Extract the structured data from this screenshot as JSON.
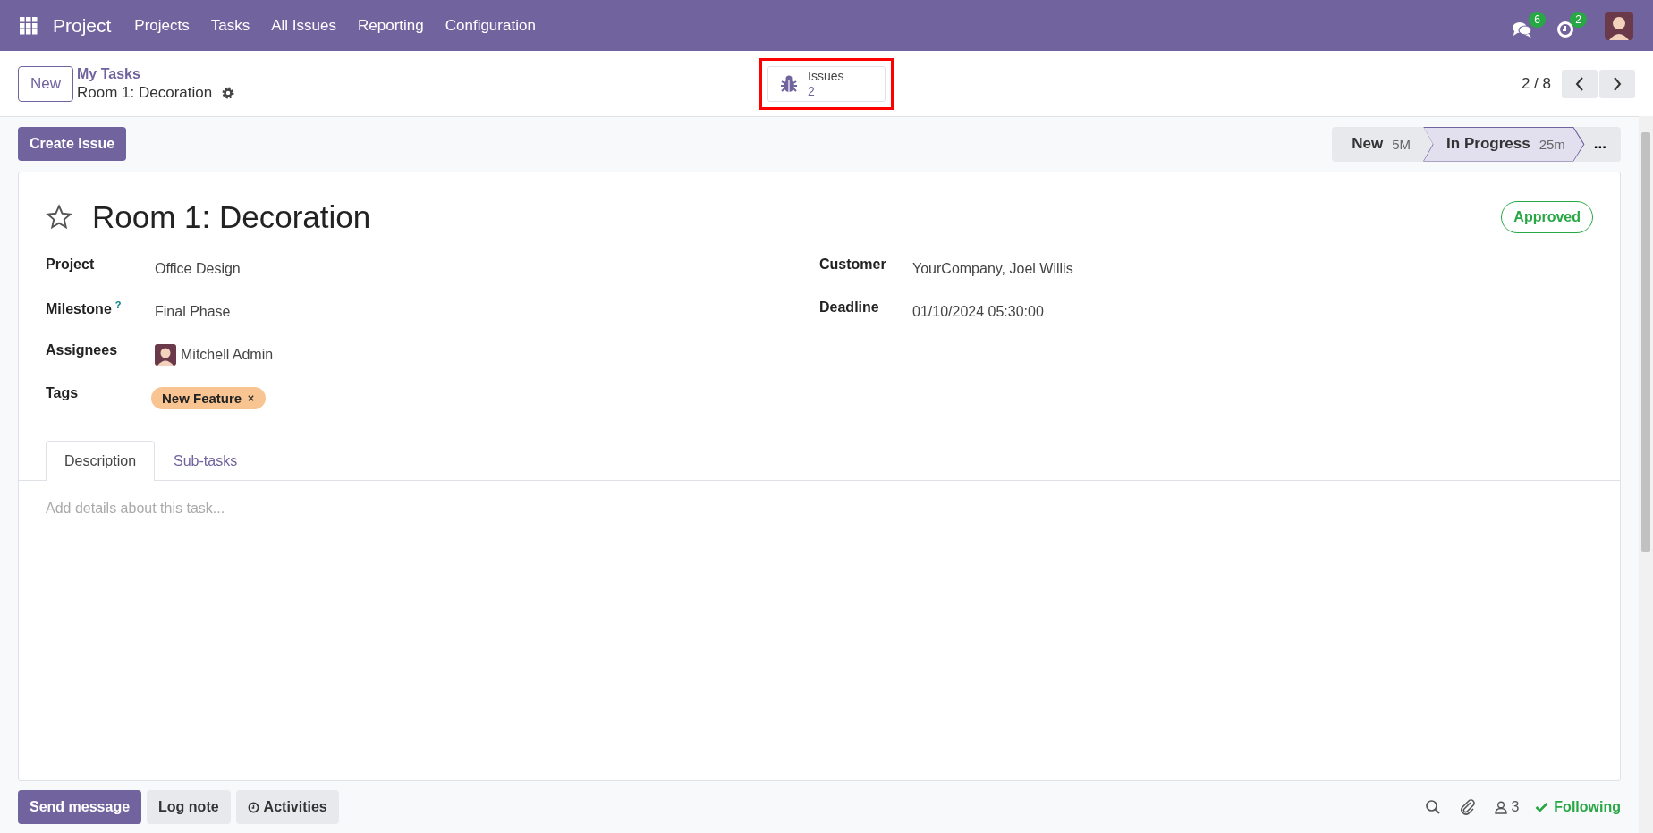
{
  "navbar": {
    "app_name": "Project",
    "menu": [
      "Projects",
      "Tasks",
      "All Issues",
      "Reporting",
      "Configuration"
    ],
    "messages_count": "6",
    "activities_count": "2"
  },
  "control_panel": {
    "new_button": "New",
    "breadcrumb_parent": "My Tasks",
    "breadcrumb_current": "Room 1: Decoration",
    "smart_button": {
      "label": "Issues",
      "value": "2",
      "highlighted": true
    },
    "pager": "2 / 8"
  },
  "create_issue_button": "Create Issue",
  "stages": [
    {
      "label": "New",
      "duration": "5M",
      "selected": false
    },
    {
      "label": "In Progress",
      "duration": "25m",
      "selected": true
    }
  ],
  "stages_more": "...",
  "form": {
    "starred": false,
    "title": "Room 1: Decoration",
    "approval": "Approved",
    "fields_left": [
      {
        "kind": "text",
        "label": "Project",
        "value": "Office Design"
      },
      {
        "kind": "text",
        "label": "Milestone",
        "help": "?",
        "value": "Final Phase"
      },
      {
        "kind": "user",
        "label": "Assignees",
        "value": "Mitchell Admin"
      },
      {
        "kind": "tags",
        "label": "Tags",
        "tags": [
          "New Feature"
        ]
      }
    ],
    "fields_right": [
      {
        "kind": "text",
        "label": "Customer",
        "value": "YourCompany, Joel Willis"
      },
      {
        "kind": "text",
        "label": "Deadline",
        "value": "01/10/2024 05:30:00"
      }
    ],
    "tabs": [
      {
        "label": "Description",
        "selected": true
      },
      {
        "label": "Sub-tasks",
        "selected": false
      }
    ],
    "description_placeholder": "Add details about this task..."
  },
  "chatter": {
    "buttons": [
      {
        "label": "Send message",
        "kind": "primary"
      },
      {
        "label": "Log note",
        "kind": "secondary"
      },
      {
        "label": "Activities",
        "kind": "activity"
      }
    ],
    "followers": "3",
    "following": "Following"
  }
}
